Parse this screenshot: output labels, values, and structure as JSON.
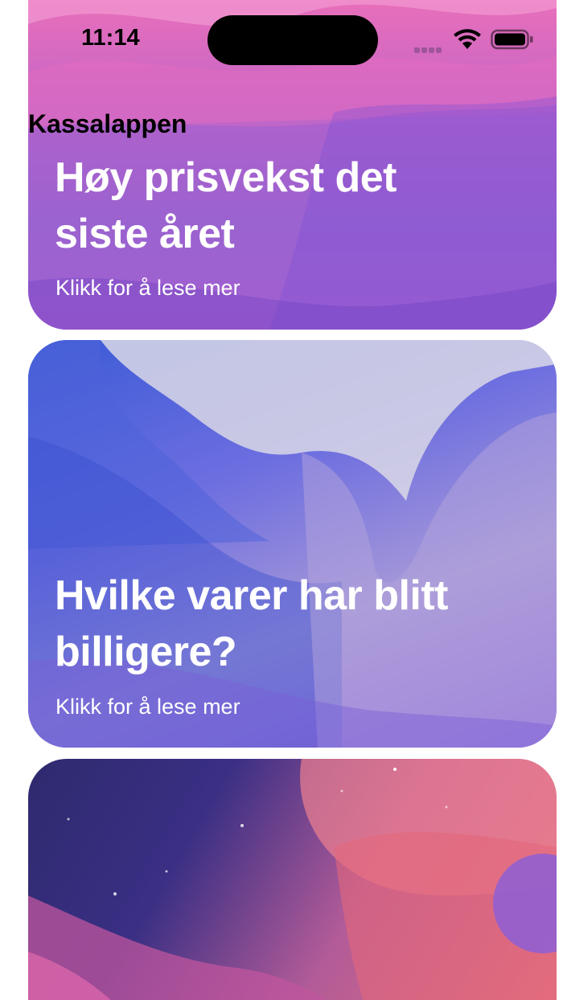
{
  "status_bar": {
    "time": "11:14",
    "icons": [
      "signal-icon",
      "wifi-icon",
      "battery-icon"
    ]
  },
  "nav": {
    "title": "Kassalappen"
  },
  "cards": [
    {
      "title": "Høy prisvekst det siste året",
      "link": "Klikk for å lese mer",
      "colors": [
        "#f071b7",
        "#c766c6",
        "#9c6ad0"
      ]
    },
    {
      "title": "Hvilke varer har blitt billigere?",
      "link": "Klikk for å lese mer",
      "colors": [
        "#3b5bd6",
        "#6d6ee0",
        "#a698d8",
        "#8e68dc"
      ]
    },
    {
      "title": "",
      "link": "",
      "colors": [
        "#2e2a6e",
        "#3a2f84",
        "#b25b98",
        "#e6737d"
      ]
    }
  ],
  "colors": {
    "background": "#ffffff",
    "text_on_card": "#ffffff",
    "text_primary": "#000000"
  }
}
